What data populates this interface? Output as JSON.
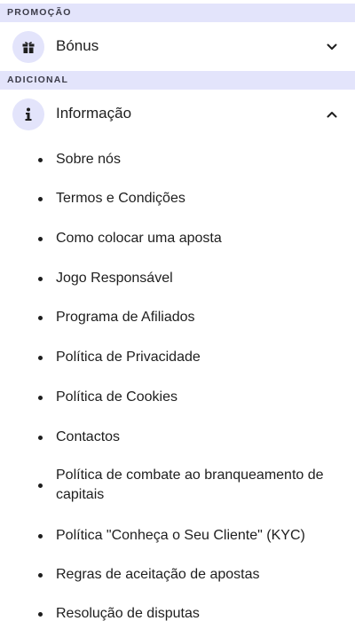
{
  "sections": {
    "promo": {
      "title": "PROMOÇÃO"
    },
    "additional": {
      "title": "ADICIONAL"
    }
  },
  "bonus": {
    "label": "Bónus",
    "icon": "gift-icon",
    "state": "collapsed"
  },
  "info": {
    "label": "Informação",
    "icon": "info-icon",
    "state": "expanded",
    "items": [
      "Sobre nós",
      "Termos e Condições",
      "Como colocar uma aposta",
      "Jogo Responsável",
      "Programa de Afiliados",
      "Política de Privacidade",
      "Política de Cookies",
      "Contactos",
      "Política de combate ao branqueamento de capitais",
      "Política \"Conheça o Seu Cliente\" (KYC)",
      "Regras de aceitação de apostas",
      "Resolução de disputas"
    ]
  },
  "colors": {
    "header_bg": "#e3e4fb",
    "text": "#1e1e1e"
  }
}
